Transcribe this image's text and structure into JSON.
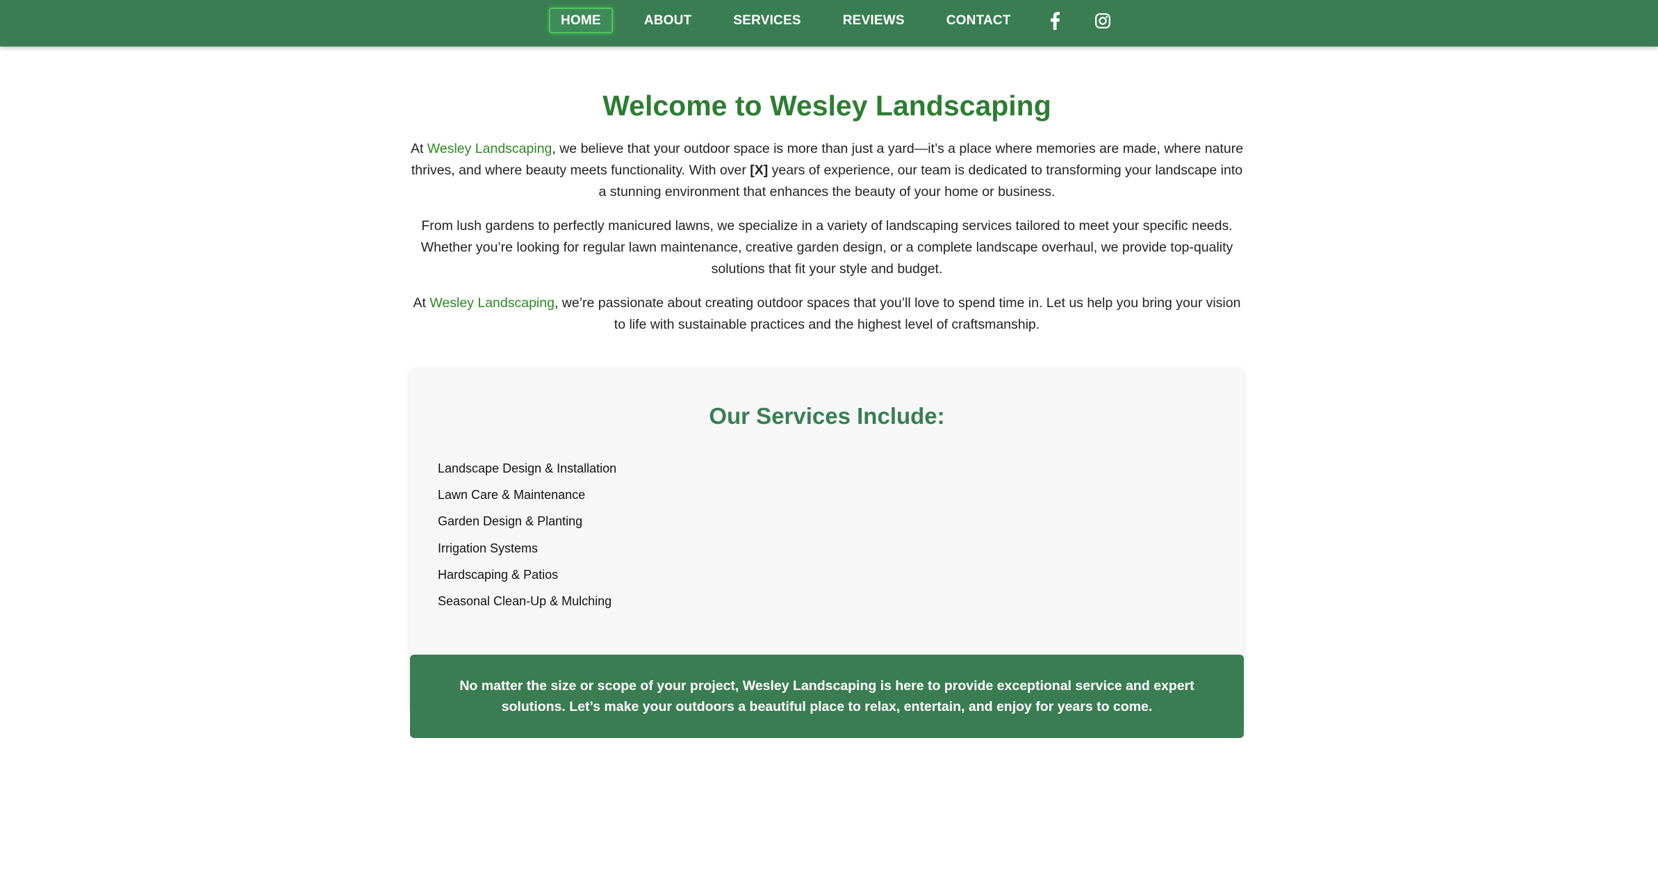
{
  "nav": {
    "items": [
      {
        "label": "HOME",
        "active": true
      },
      {
        "label": "ABOUT",
        "active": false
      },
      {
        "label": "SERVICES",
        "active": false
      },
      {
        "label": "REVIEWS",
        "active": false
      },
      {
        "label": "CONTACT",
        "active": false
      }
    ],
    "social_icons": [
      "facebook-icon",
      "instagram-icon"
    ]
  },
  "main": {
    "heading": "Welcome to Wesley Landscaping",
    "paragraph1": {
      "prefix": "At ",
      "brand": "Wesley Landscaping",
      "middle": ", we believe that your outdoor space is more than just a yard—it’s a place where memories are made, where nature thrives, and where beauty meets functionality. With over ",
      "bold": "[X]",
      "suffix": " years of experience, our team is dedicated to transforming your landscape into a stunning environment that enhances the beauty of your home or business."
    },
    "paragraph2": "From lush gardens to perfectly manicured lawns, we specialize in a variety of landscaping services tailored to meet your specific needs. Whether you’re looking for regular lawn maintenance, creative garden design, or a complete landscape overhaul, we provide top-quality solutions that fit your style and budget.",
    "paragraph3": {
      "prefix": "At ",
      "brand": "Wesley Landscaping",
      "suffix": ", we’re passionate about creating outdoor spaces that you’ll love to spend time in. Let us help you bring your vision to life with sustainable practices and the highest level of craftsmanship."
    }
  },
  "services": {
    "heading": "Our Services Include:",
    "items": [
      "Landscape Design & Installation",
      "Lawn Care & Maintenance",
      "Garden Design & Planting",
      "Irrigation Systems",
      "Hardscaping & Patios",
      "Seasonal Clean-Up & Mulching"
    ]
  },
  "cta": {
    "text": "No matter the size or scope of your project, Wesley Landscaping is here to provide exceptional service and expert solutions. Let’s make your outdoors a beautiful place to relax, entertain, and enjoy for years to come."
  },
  "colors": {
    "nav_bg": "#3a7d53",
    "heading_green": "#2e7d32",
    "brand_green": "#2a8a20",
    "services_bg": "#f7f7f7",
    "active_border": "#52c45d"
  }
}
